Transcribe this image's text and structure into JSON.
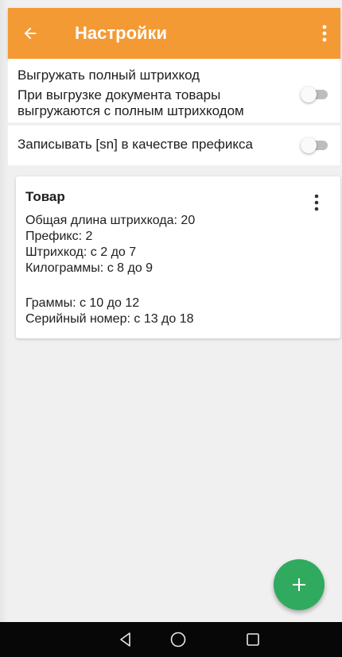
{
  "appbar": {
    "title": "Настройки",
    "back_icon": "arrow-left-icon",
    "menu_icon": "more-vertical-icon",
    "color": "#f49a34"
  },
  "settings": [
    {
      "label": "Выгружать полный штрихкод",
      "description": "При выгрузке документа товары выгружаются с полным штрихкодом",
      "enabled": false
    },
    {
      "label": "Записывать [sn] в качестве префикса",
      "enabled": false
    }
  ],
  "card": {
    "title": "Товар",
    "lines": [
      "Общая длина штрихкода: 20",
      "Префикс: 2",
      "Штрихкод: с 2 до 7",
      "Килограммы: с 8 до 9",
      "Граммы: с 10 до 12",
      "Серийный номер: с 13 до 18"
    ],
    "menu_icon": "more-vertical-icon"
  },
  "fab": {
    "icon": "plus-icon",
    "color": "#2faa5e"
  },
  "navbar": {
    "back_icon": "triangle-back-icon",
    "home_icon": "circle-home-icon",
    "recent_icon": "square-recent-icon"
  }
}
